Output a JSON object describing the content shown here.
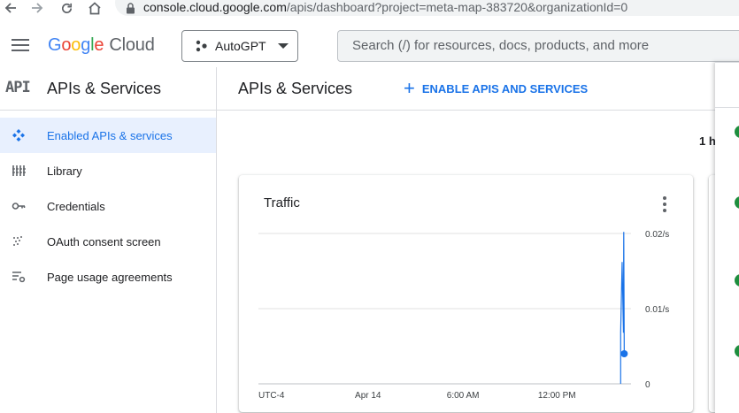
{
  "browser": {
    "url_host": "console.cloud.google.com",
    "url_path": "/apis/dashboard?project=meta-map-383720&organizationId=0"
  },
  "header": {
    "logo_google": [
      "G",
      "o",
      "o",
      "g",
      "l",
      "e"
    ],
    "logo_cloud": "Cloud",
    "project": "AutoGPT",
    "search_placeholder": "Search (/) for resources, docs, products, and more"
  },
  "sidebar": {
    "title_icon": "API",
    "title": "APIs & Services",
    "items": [
      {
        "label": "Enabled APIs & services",
        "icon": "apis-icon",
        "active": true
      },
      {
        "label": "Library",
        "icon": "library-icon",
        "active": false
      },
      {
        "label": "Credentials",
        "icon": "key-icon",
        "active": false
      },
      {
        "label": "OAuth consent screen",
        "icon": "oauth-icon",
        "active": false
      },
      {
        "label": "Page usage agreements",
        "icon": "settings-list-icon",
        "active": false
      }
    ]
  },
  "main": {
    "title": "APIs & Services",
    "enable_button": "ENABLE APIS AND SERVICES",
    "time_range": "1 h"
  },
  "chart_data": {
    "type": "line",
    "title": "Traffic",
    "x_tick_labels": [
      "UTC-4",
      "Apr 14",
      "6:00 AM",
      "12:00 PM"
    ],
    "y_tick_labels": [
      "0.02/s",
      "0.01/s",
      "0"
    ],
    "ylim": [
      0,
      0.02
    ],
    "series": [
      {
        "color": "#1a73e8",
        "points": [
          [
            0.9722,
            0.0
          ],
          [
            0.9722,
            0.0068
          ],
          [
            0.9761,
            0.0162
          ],
          [
            0.9797,
            0.0068
          ],
          [
            0.9805,
            0.0202
          ],
          [
            0.9818,
            0.004
          ]
        ]
      }
    ],
    "last_point_value": 0.004,
    "grid": true
  },
  "colors": {
    "accent": "#1a73e8",
    "active_bg": "#e8f0fe",
    "status_ok": "#1e8e3e"
  }
}
